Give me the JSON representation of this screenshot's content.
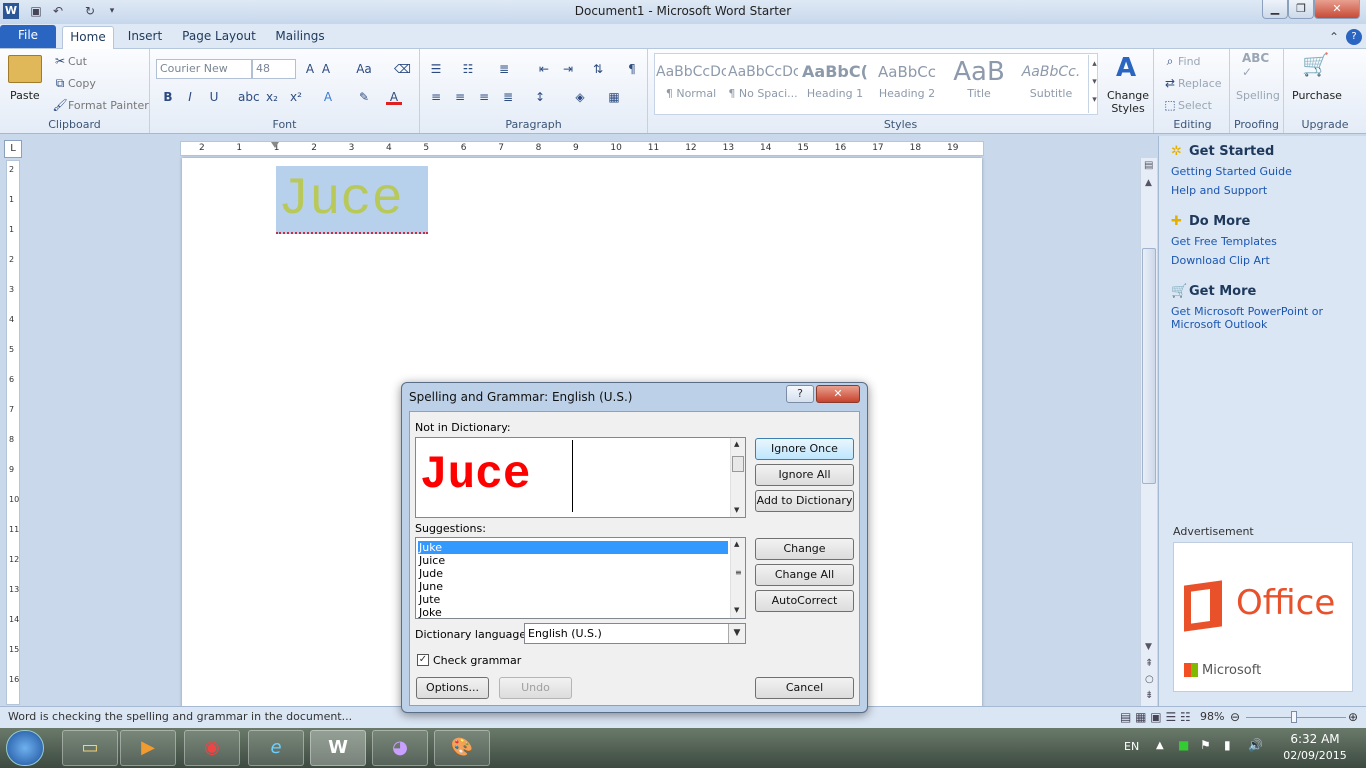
{
  "window": {
    "title": "Document1  -  Microsoft Word Starter",
    "minimize": "▁",
    "restore": "❐",
    "close": "✕"
  },
  "tabs": [
    {
      "label": "File"
    },
    {
      "label": "Home"
    },
    {
      "label": "Insert"
    },
    {
      "label": "Page Layout"
    },
    {
      "label": "Mailings"
    }
  ],
  "ribbon": {
    "clipboard": {
      "label": "Clipboard",
      "paste": "Paste",
      "cut": "Cut",
      "copy": "Copy",
      "format_painter": "Format Painter"
    },
    "font": {
      "label": "Font",
      "font_name": "Courier New",
      "font_size": "48"
    },
    "paragraph": {
      "label": "Paragraph"
    },
    "styles": {
      "label": "Styles",
      "items": [
        {
          "sample": "AaBbCcDc",
          "name": "¶ Normal"
        },
        {
          "sample": "AaBbCcDc",
          "name": "¶ No Spaci..."
        },
        {
          "sample": "AaBbC(",
          "name": "Heading 1"
        },
        {
          "sample": "AaBbCc",
          "name": "Heading 2"
        },
        {
          "sample": "AaB",
          "name": "Title"
        },
        {
          "sample": "AaBbCc.",
          "name": "Subtitle"
        }
      ],
      "change_styles": "Change Styles"
    },
    "editing": {
      "label": "Editing",
      "find": "Find",
      "replace": "Replace",
      "select": "Select"
    },
    "proofing": {
      "label": "Proofing",
      "spelling": "Spelling"
    },
    "upgrade": {
      "label": "Upgrade",
      "purchase": "Purchase"
    }
  },
  "ruler": {
    "labels": [
      "2",
      "1",
      "1",
      "2",
      "3",
      "4",
      "5",
      "6",
      "7",
      "8",
      "9",
      "10",
      "11",
      "12",
      "13",
      "14",
      "15",
      "16",
      "17",
      "18",
      "19"
    ],
    "vlabels": [
      "2",
      "1",
      "1",
      "2",
      "3",
      "4",
      "5",
      "6",
      "7",
      "8",
      "9",
      "10",
      "11",
      "12",
      "13",
      "14",
      "15",
      "16"
    ]
  },
  "document": {
    "text": "Juce"
  },
  "task_pane": {
    "get_started": {
      "title": "Get Started",
      "links": [
        "Getting Started Guide",
        "Help and Support"
      ]
    },
    "do_more": {
      "title": "Do More",
      "links": [
        "Get Free Templates",
        "Download Clip Art"
      ]
    },
    "get_more": {
      "title": "Get More",
      "links": [
        "Get Microsoft PowerPoint or Microsoft Outlook"
      ]
    },
    "advertisement": "Advertisement",
    "office_logo": "Office",
    "microsoft_logo": "Microsoft"
  },
  "status_bar": {
    "message": "Word is checking the spelling and grammar in the document...",
    "zoom": "98%"
  },
  "dialog": {
    "title": "Spelling and Grammar: English (U.S.)",
    "help": "?",
    "close": "✕",
    "not_in_dictionary_label": "Not in Dictionary:",
    "not_in_dictionary_word": "Juce",
    "suggestions_label": "Suggestions:",
    "suggestions": [
      "Juke",
      "Juice",
      "Jude",
      "June",
      "Jute",
      "Joke"
    ],
    "dictionary_language_label": "Dictionary language:",
    "dictionary_language": "English (U.S.)",
    "check_grammar": "Check grammar",
    "buttons": {
      "ignore_once": "Ignore Once",
      "ignore_all": "Ignore All",
      "add_to_dictionary": "Add to Dictionary",
      "change": "Change",
      "change_all": "Change All",
      "autocorrect": "AutoCorrect",
      "options": "Options...",
      "undo": "Undo",
      "cancel": "Cancel"
    }
  },
  "taskbar": {
    "language": "EN",
    "time": "6:32 AM",
    "date": "02/09/2015"
  }
}
